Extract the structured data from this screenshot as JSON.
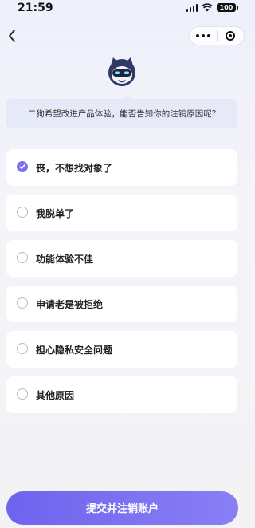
{
  "status_bar": {
    "time": "21:59",
    "battery": "100"
  },
  "nav": {
    "back_icon": "chevron-left-icon",
    "more_icon": "more-dots-icon",
    "close_icon": "target-icon"
  },
  "mascot": {
    "icon": "robot-cat-mascot-icon"
  },
  "prompt": {
    "text": "二狗希望改进产品体验，能否告知你的注销原因呢?"
  },
  "options": [
    {
      "label": "丧，不想找对象了",
      "selected": true
    },
    {
      "label": "我脱单了",
      "selected": false
    },
    {
      "label": "功能体验不佳",
      "selected": false
    },
    {
      "label": "申请老是被拒绝",
      "selected": false
    },
    {
      "label": "担心隐私安全问题",
      "selected": false
    },
    {
      "label": "其他原因",
      "selected": false
    }
  ],
  "submit": {
    "label": "提交并注销账户"
  },
  "colors": {
    "accent": "#7b70ee",
    "bubble": "#e5e9f8",
    "background": "#f3f3f6"
  }
}
